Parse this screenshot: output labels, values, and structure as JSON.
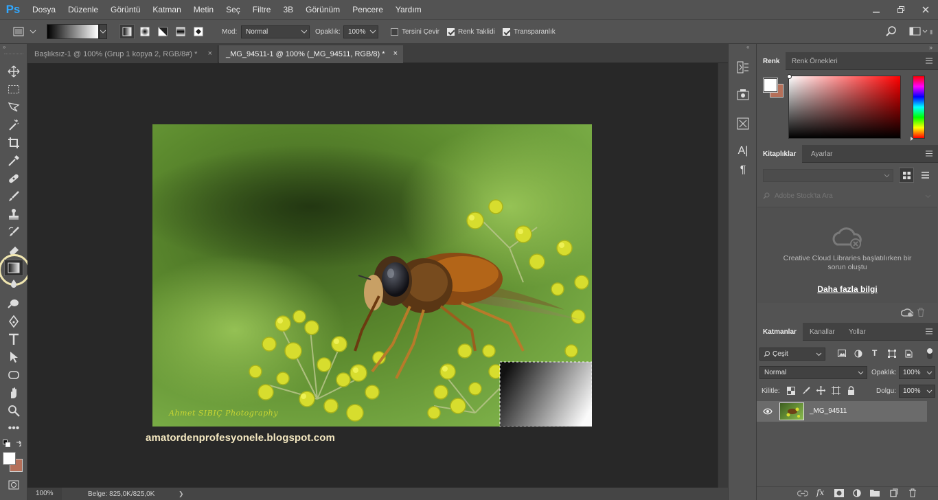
{
  "app": {
    "logo": "Ps"
  },
  "menu": [
    "Dosya",
    "Düzenle",
    "Görüntü",
    "Katman",
    "Metin",
    "Seç",
    "Filtre",
    "3B",
    "Görünüm",
    "Pencere",
    "Yardım"
  ],
  "options": {
    "mode_label": "Mod:",
    "mode_value": "Normal",
    "opacity_label": "Opaklık:",
    "opacity_value": "100%",
    "reverse_label": "Tersini Çevir",
    "reverse_checked": false,
    "dither_label": "Renk Taklidi",
    "dither_checked": true,
    "transparency_label": "Transparanlık",
    "transparency_checked": true
  },
  "tabs": [
    {
      "label": "Başlıksız-1 @ 100% (Grup 1 kopya 2, RGB/8#) *",
      "close": "×",
      "active": false
    },
    {
      "label": "_MG_94511-1 @ 100% (_MG_94511, RGB/8) *",
      "close": "×",
      "active": true
    }
  ],
  "canvas": {
    "watermark": "Ahmet SIBIÇ Photography",
    "url_text": "amatordenprofesyonele.blogspot.com"
  },
  "status": {
    "zoom": "100%",
    "doc_info": "Belge: 825,0K/825,0K",
    "arrow": "❯"
  },
  "color_panel": {
    "tabs": [
      "Renk",
      "Renk Örnekleri"
    ],
    "foreground": "#ffffff",
    "background": "#b5705a"
  },
  "libraries_panel": {
    "tabs": [
      "Kitaplıklar",
      "Ayarlar"
    ],
    "search_placeholder": "Adobe Stock'ta Ara",
    "message": "Creative Cloud Libraries başlatılırken bir sorun oluştu",
    "more_link": "Daha fazla bilgi"
  },
  "layers_panel": {
    "tabs": [
      "Katmanlar",
      "Kanallar",
      "Yollar"
    ],
    "filter_value": "Çeşit",
    "blend_mode": "Normal",
    "opacity_label": "Opaklık:",
    "opacity_value": "100%",
    "lock_label": "Kilitle:",
    "fill_label": "Dolgu:",
    "fill_value": "100%",
    "layers": [
      {
        "name": "_MG_94511",
        "visible": true
      }
    ],
    "footer_fx": "fx"
  },
  "colors": {
    "accent": "#31a8ff",
    "panel_bg": "#535353",
    "canvas_bg": "#282828",
    "highlight_ring": "#f0e6b0"
  },
  "icons": [
    "move-icon",
    "marquee-icon",
    "lasso-icon",
    "magic-wand-icon",
    "crop-icon",
    "eyedropper-icon",
    "healing-icon",
    "brush-icon",
    "stamp-icon",
    "history-brush-icon",
    "eraser-icon",
    "gradient-icon",
    "blur-icon",
    "dodge-icon",
    "pen-icon",
    "type-icon",
    "path-select-icon",
    "shape-icon",
    "hand-icon",
    "zoom-icon",
    "more-icon",
    "quickmask-icon"
  ]
}
